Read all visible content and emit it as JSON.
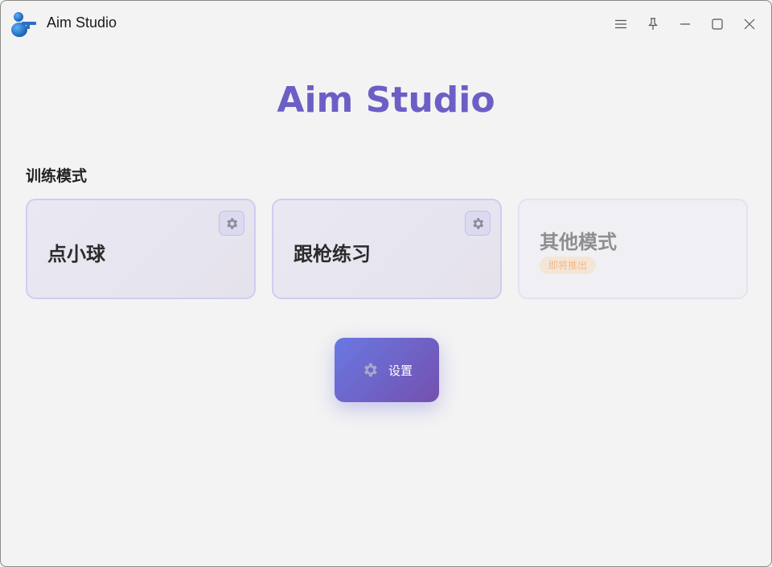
{
  "window": {
    "title": "Aim Studio",
    "controls": [
      "menu-icon",
      "pin-icon",
      "minimize-icon",
      "maximize-icon",
      "close-icon"
    ]
  },
  "hero": {
    "title": "Aim Studio"
  },
  "modes": {
    "section_label": "训练模式",
    "cards": [
      {
        "title": "点小球",
        "has_settings": true
      },
      {
        "title": "跟枪练习",
        "has_settings": true
      },
      {
        "title": "其他模式",
        "badge": "即将推出",
        "disabled": true
      }
    ]
  },
  "settings_button": {
    "label": "设置",
    "icon": "gear-icon"
  },
  "colors": {
    "accent": "#6b5fc6",
    "button_gradient_start": "#6a78e2",
    "button_gradient_end": "#7450ae",
    "badge_text": "#f0b98a"
  }
}
